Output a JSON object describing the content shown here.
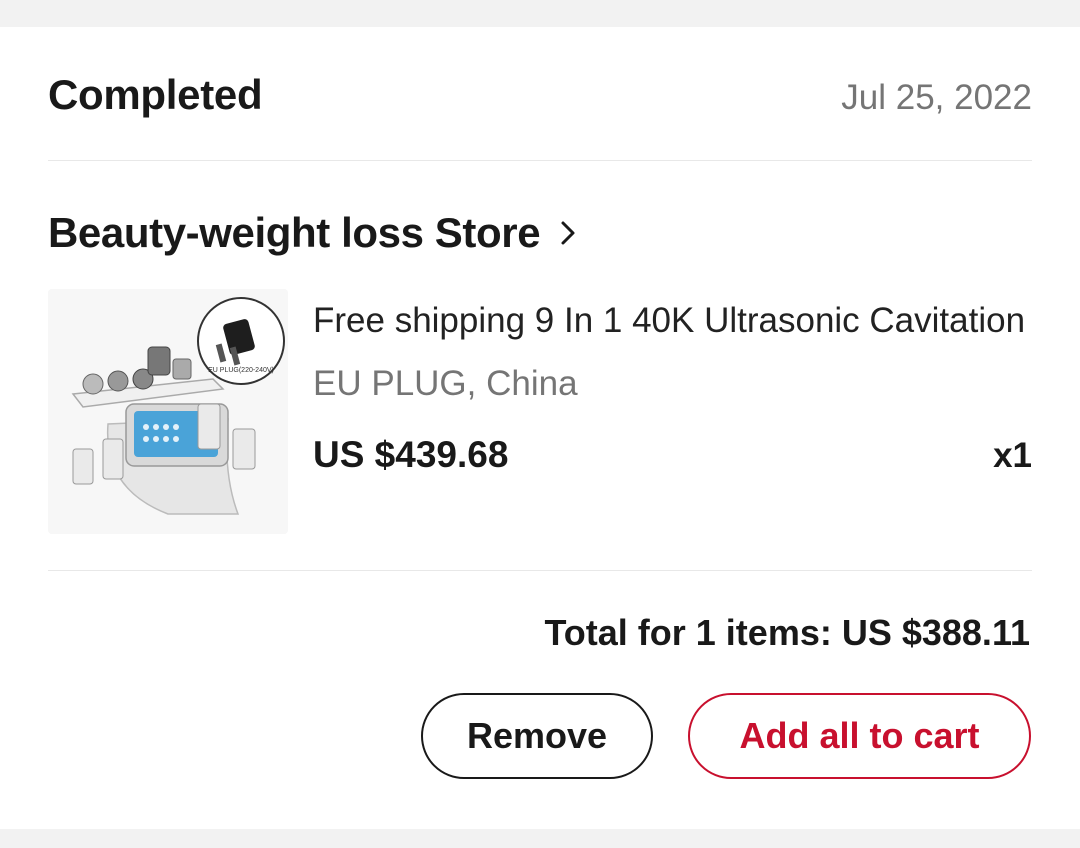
{
  "order": {
    "status": "Completed",
    "date": "Jul 25, 2022"
  },
  "store": {
    "name": "Beauty-weight loss Store",
    "icon": "chevron-right-icon"
  },
  "product": {
    "title": "Free shipping 9 In 1 40K Ultrasonic Cavitation",
    "variant": "EU PLUG, China",
    "price": "US $439.68",
    "quantity": "x1",
    "plug_badge_text": "EU PLUG(220-240V)"
  },
  "summary": {
    "total": "Total for 1 items: US $388.11"
  },
  "actions": {
    "remove_label": "Remove",
    "add_all_label": "Add all to cart"
  },
  "colors": {
    "accent": "#c8102e",
    "text_secondary": "#757575",
    "background": "#f2f2f2"
  }
}
